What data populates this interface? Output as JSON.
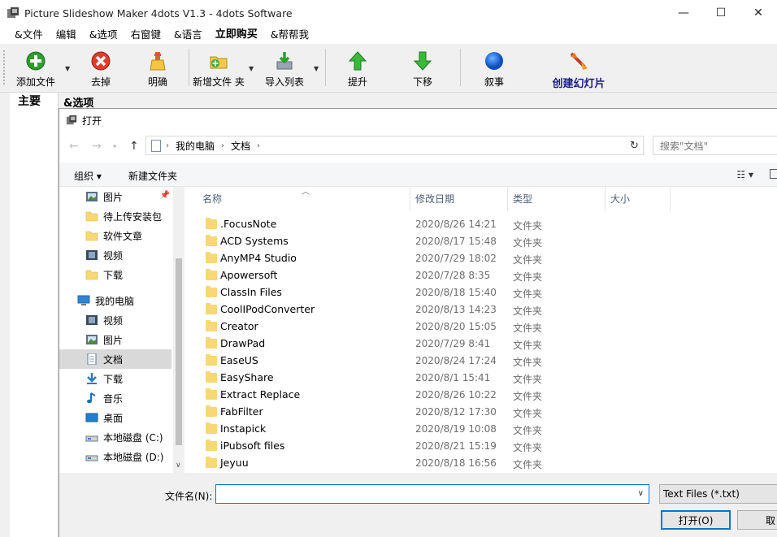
{
  "app": {
    "title": "Picture Slideshow Maker 4dots V1.3 - 4dots Software",
    "window_controls": [
      "—",
      "☐",
      "✕"
    ]
  },
  "menu": [
    "&文件",
    "编辑",
    "&选项",
    "右窗键",
    "&语言",
    "立即购买",
    "&帮帮我"
  ],
  "toolbar": {
    "add_file": "添加文件",
    "remove": "去掉",
    "clear": "明确",
    "new_folder": "新增文件 夹",
    "import_list": "导入列表",
    "move_up": "提升",
    "move_down": "下移",
    "narrate": "叙事",
    "create_slideshow": "创建幻灯片"
  },
  "main": {
    "left_label": "主要",
    "tab_label": "&选项"
  },
  "dialog": {
    "title": "打开",
    "breadcrumbs": [
      "我的电脑",
      "文档"
    ],
    "search_placeholder": "搜索\"文档\"",
    "organize": "组织 ▾",
    "new_folder": "新建文件夹",
    "columns": {
      "name": "名称",
      "date": "修改日期",
      "type": "类型",
      "size": "大小"
    },
    "nav_items": [
      {
        "label": "图片",
        "icon": "pictures-icon"
      },
      {
        "label": "待上传安装包",
        "icon": "folder-icon"
      },
      {
        "label": "软件文章",
        "icon": "folder-icon"
      },
      {
        "label": "视频",
        "icon": "videos-icon"
      },
      {
        "label": "下载",
        "icon": "folder-icon"
      },
      {
        "label": "我的电脑",
        "icon": "computer-icon"
      },
      {
        "label": "视频",
        "icon": "videos-icon"
      },
      {
        "label": "图片",
        "icon": "pictures-icon"
      },
      {
        "label": "文档",
        "icon": "documents-icon"
      },
      {
        "label": "下载",
        "icon": "download-icon"
      },
      {
        "label": "音乐",
        "icon": "music-icon"
      },
      {
        "label": "桌面",
        "icon": "desktop-icon"
      },
      {
        "label": "本地磁盘 (C:)",
        "icon": "drive-icon"
      },
      {
        "label": "本地磁盘 (D:)",
        "icon": "drive-icon"
      }
    ],
    "files": [
      {
        "name": ".FocusNote",
        "date": "2020/8/26 14:21",
        "type": "文件夹"
      },
      {
        "name": "ACD Systems",
        "date": "2020/8/17 15:48",
        "type": "文件夹"
      },
      {
        "name": "AnyMP4 Studio",
        "date": "2020/7/29 18:02",
        "type": "文件夹"
      },
      {
        "name": "Apowersoft",
        "date": "2020/7/28 8:35",
        "type": "文件夹"
      },
      {
        "name": "ClassIn Files",
        "date": "2020/8/18 15:40",
        "type": "文件夹"
      },
      {
        "name": "CoolIPodConverter",
        "date": "2020/8/13 14:23",
        "type": "文件夹"
      },
      {
        "name": "Creator",
        "date": "2020/8/20 15:05",
        "type": "文件夹"
      },
      {
        "name": "DrawPad",
        "date": "2020/7/29 8:41",
        "type": "文件夹"
      },
      {
        "name": "EaseUS",
        "date": "2020/8/24 17:24",
        "type": "文件夹"
      },
      {
        "name": "EasyShare",
        "date": "2020/8/1 15:41",
        "type": "文件夹"
      },
      {
        "name": "Extract Replace",
        "date": "2020/8/26 10:22",
        "type": "文件夹"
      },
      {
        "name": "FabFilter",
        "date": "2020/8/12 17:30",
        "type": "文件夹"
      },
      {
        "name": "Instapick",
        "date": "2020/8/19 10:08",
        "type": "文件夹"
      },
      {
        "name": "iPubsoft files",
        "date": "2020/8/21 15:19",
        "type": "文件夹"
      },
      {
        "name": "Jeyuu",
        "date": "2020/8/18 16:56",
        "type": "文件夹"
      }
    ],
    "filename_label": "文件名(N):",
    "filename_value": "",
    "filter": "Text Files (*.txt)",
    "open_button": "打开(O)",
    "cancel_button": "取"
  }
}
